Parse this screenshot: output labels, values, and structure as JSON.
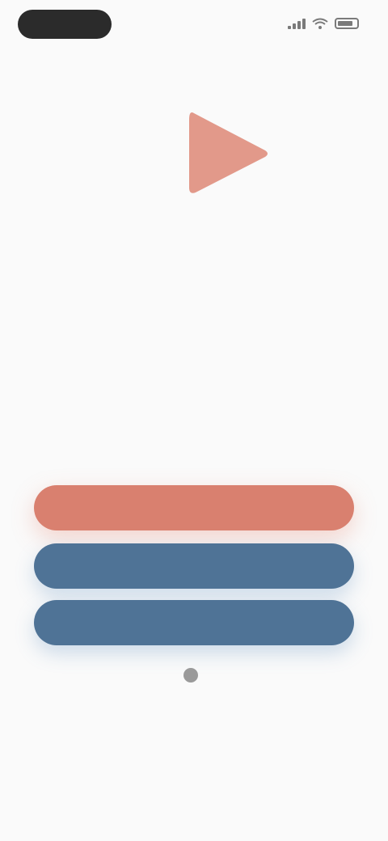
{
  "status_bar": {
    "time": "",
    "icons": [
      "signal-icon",
      "wifi-icon",
      "battery-icon"
    ]
  },
  "logo": {
    "line1": "",
    "line2": "",
    "line3": "",
    "icon": "play-icon"
  },
  "tagline": "",
  "buttons": {
    "primary": "",
    "secondary_1": "",
    "secondary_2": ""
  },
  "footer": {
    "icon": "info-icon",
    "text": ""
  },
  "colors": {
    "primary": "#d9806f",
    "secondary": "#4f7396",
    "logo": "#e8a89a",
    "background": "#fafafa"
  }
}
